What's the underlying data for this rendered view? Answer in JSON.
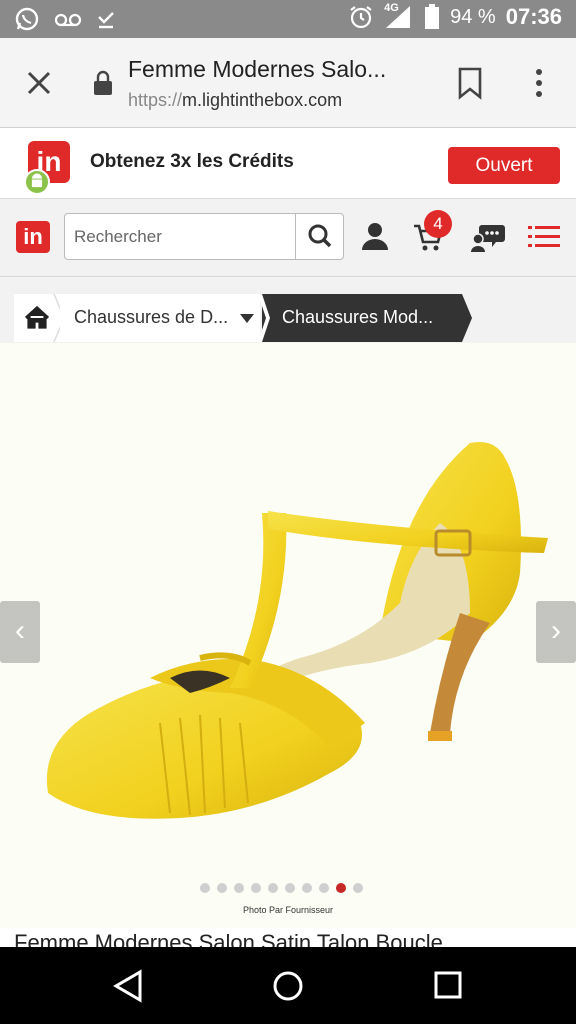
{
  "status_bar": {
    "battery": "94 %",
    "network": "4G",
    "time": "07:36"
  },
  "browser": {
    "page_title": "Femme Modernes Salo...",
    "url_scheme": "https://",
    "url_host": "m.lightinthebox.com"
  },
  "promo": {
    "logo_text": "in",
    "message": "Obtenez 3x les Crédits",
    "open_label": "Ouvert"
  },
  "header": {
    "logo_text": "in",
    "search_placeholder": "Rechercher",
    "cart_count": "4"
  },
  "breadcrumb": {
    "items": [
      {
        "label": "Chaussures de D..."
      },
      {
        "label": "Chaussures Mod..."
      }
    ]
  },
  "gallery": {
    "prev_arrow": "‹",
    "next_arrow": "›",
    "photo_count": 10,
    "active_index": 8,
    "credit": "Photo Par Fournisseur"
  },
  "product": {
    "title": "Femme Modernes Salon Satin Talon Boucle"
  },
  "colors": {
    "brand_red": "#e02a2a",
    "shoe_yellow": "#f2d11f"
  }
}
